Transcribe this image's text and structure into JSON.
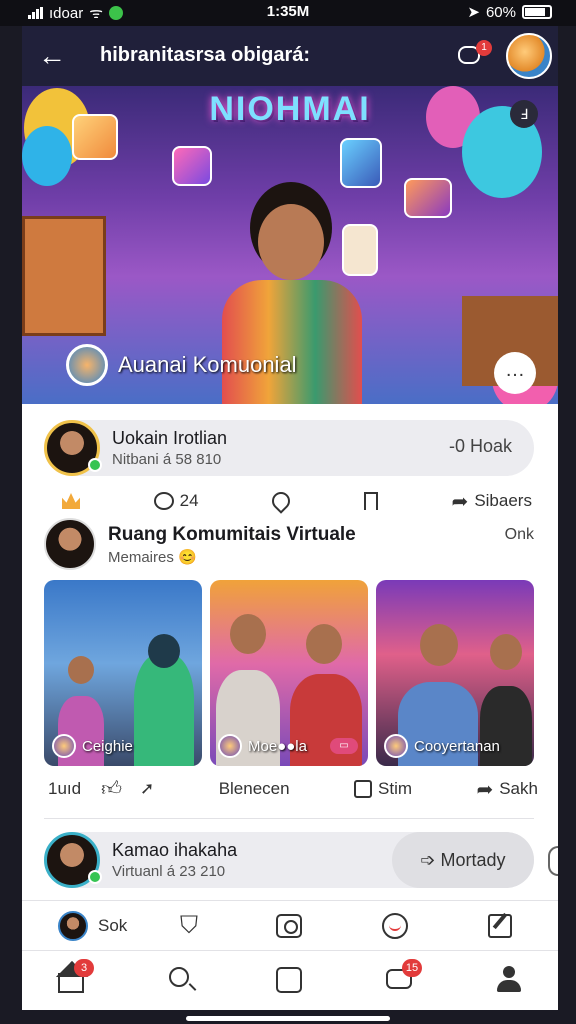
{
  "status_bar": {
    "carrier": "ıdoar",
    "time": "1:35M",
    "battery": "60%"
  },
  "header": {
    "title": "hibranitasrsa obigará:",
    "notification_count": "1"
  },
  "hero": {
    "title": "NIOHMAI",
    "handle": "Auanai Komuonial",
    "more": "…"
  },
  "comment_1": {
    "name": "Uokain Irotlian",
    "meta": "Nitbani á 58 810",
    "action": "-0 Hoak"
  },
  "actions_1": {
    "comments": "24",
    "share": "Sibaers"
  },
  "post": {
    "title": "Ruang Komumitais Virtuale",
    "subtitle": "Memaires",
    "time": "Onk",
    "photos": [
      {
        "label": "Ceighie"
      },
      {
        "label": "Moe●●la"
      },
      {
        "label": "Cooyertanan"
      }
    ]
  },
  "actions_2": {
    "left": "1uıd",
    "middle": "Blenecen",
    "save": "Stim",
    "share": "Sakh"
  },
  "comment_2": {
    "name": "Kamao ihakaha",
    "meta": "Virtuanl á 23 210",
    "action": "Mortady"
  },
  "shortcut_bar": {
    "avatar_label": "Sok"
  },
  "tab_bar": {
    "home_badge": "3",
    "chat_badge": "15"
  },
  "colors": {
    "header_bg": "#20203a",
    "badge_red": "#e23b3b",
    "online_green": "#36c452"
  }
}
